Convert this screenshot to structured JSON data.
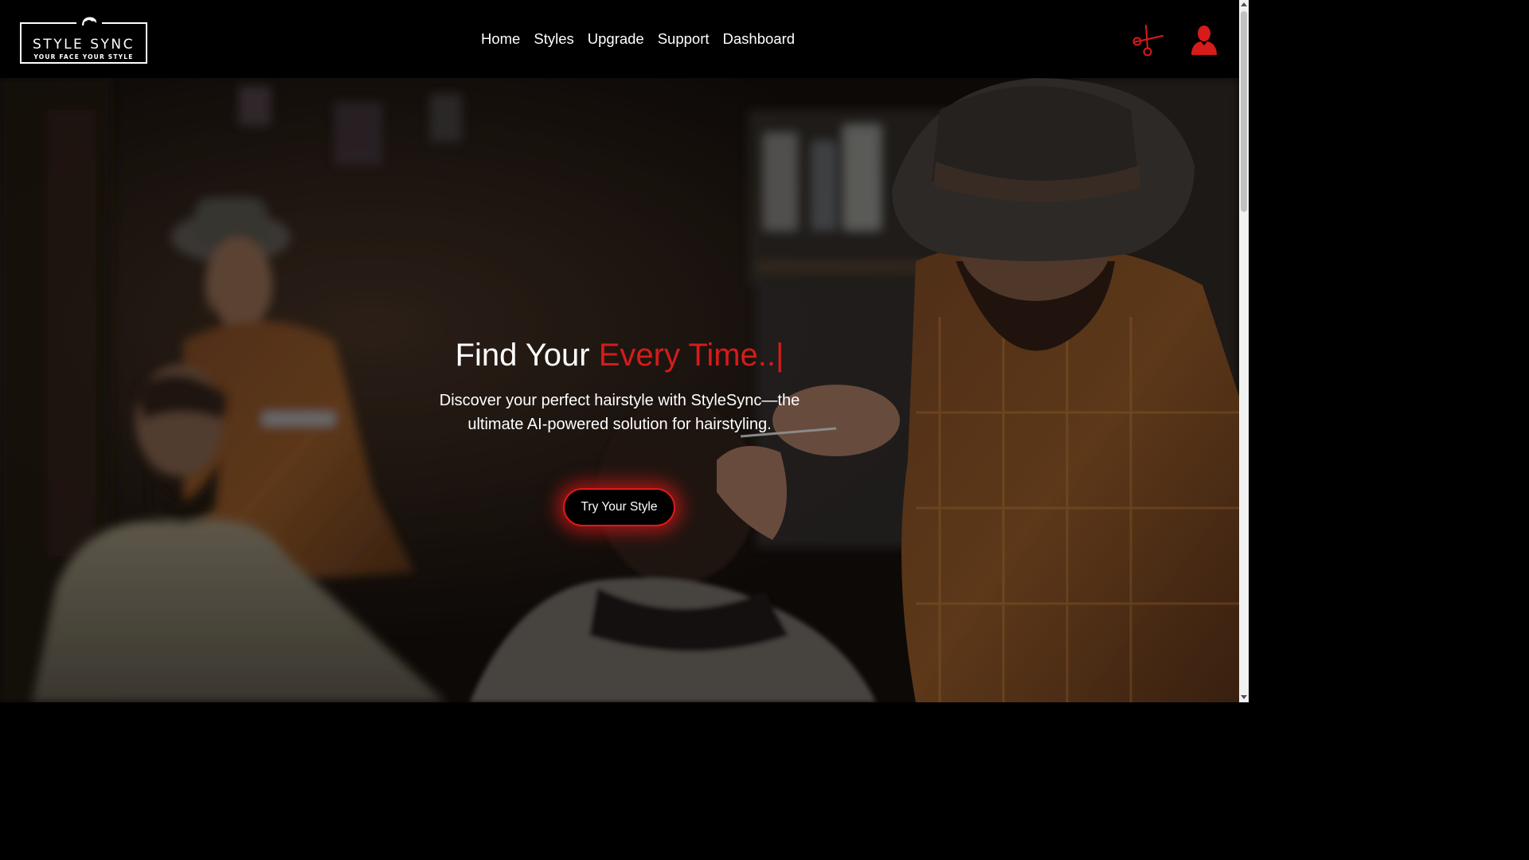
{
  "brand": {
    "name": "STYLE SYNC",
    "tagline": "YOUR FACE YOUR STYLE"
  },
  "nav": {
    "items": [
      {
        "label": "Home"
      },
      {
        "label": "Styles"
      },
      {
        "label": "Upgrade"
      },
      {
        "label": "Support"
      },
      {
        "label": "Dashboard"
      }
    ]
  },
  "header_icons": {
    "scissors": "scissors-icon",
    "user": "user-icon",
    "accent_color": "#d61b1b"
  },
  "hero": {
    "title_prefix": "Find Your ",
    "title_accent": "Every Time..",
    "title_cursor": "|",
    "description": "Discover your perfect hairstyle with StyleSync—the ultimate AI-powered solution for hairstyling.",
    "cta_label": "Try Your Style"
  },
  "colors": {
    "background": "#000000",
    "accent": "#d61b1b",
    "text": "#ffffff"
  }
}
